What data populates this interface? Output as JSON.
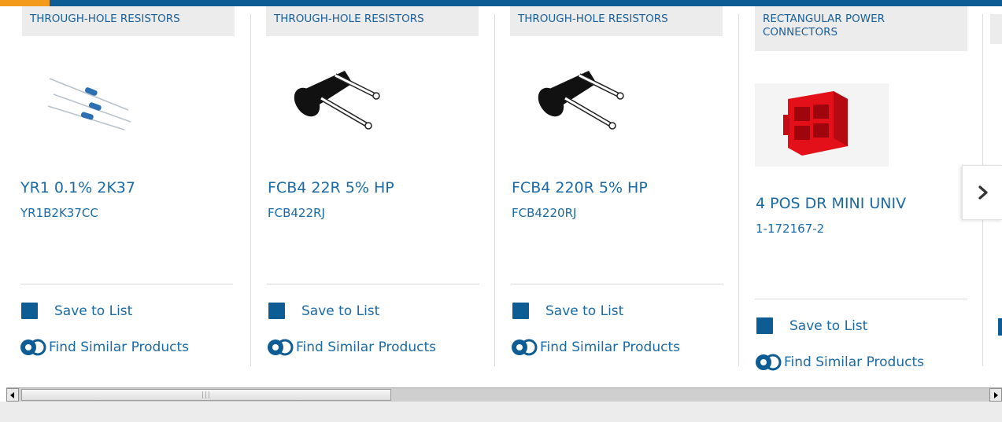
{
  "products": [
    {
      "category": "THROUGH-HOLE RESISTORS",
      "title": "YR1 0.1% 2K37",
      "part_number": "YR1B2K37CC",
      "image": "resistor-strip-image"
    },
    {
      "category": "THROUGH-HOLE RESISTORS",
      "title": "FCB4 22R 5% HP",
      "part_number": "FCB422RJ",
      "image": "power-resistor-image"
    },
    {
      "category": "THROUGH-HOLE RESISTORS",
      "title": "FCB4 220R 5% HP",
      "part_number": "FCB4220RJ",
      "image": "power-resistor-image"
    },
    {
      "category": "RECTANGULAR POWER CONNECTORS",
      "title": "4 POS DR MINI UNIV",
      "part_number": "1-172167-2",
      "image": "red-connector-image"
    }
  ],
  "actions": {
    "save_to_list": "Save to List",
    "find_similar": "Find Similar Products"
  },
  "colors": {
    "brand_blue": "#0d5c93",
    "link_blue": "#1a6aa6",
    "accent_orange": "#f39a1b"
  },
  "icons": {
    "next": "chevron-right-icon",
    "save": "list-icon",
    "similar": "gear-icon"
  }
}
